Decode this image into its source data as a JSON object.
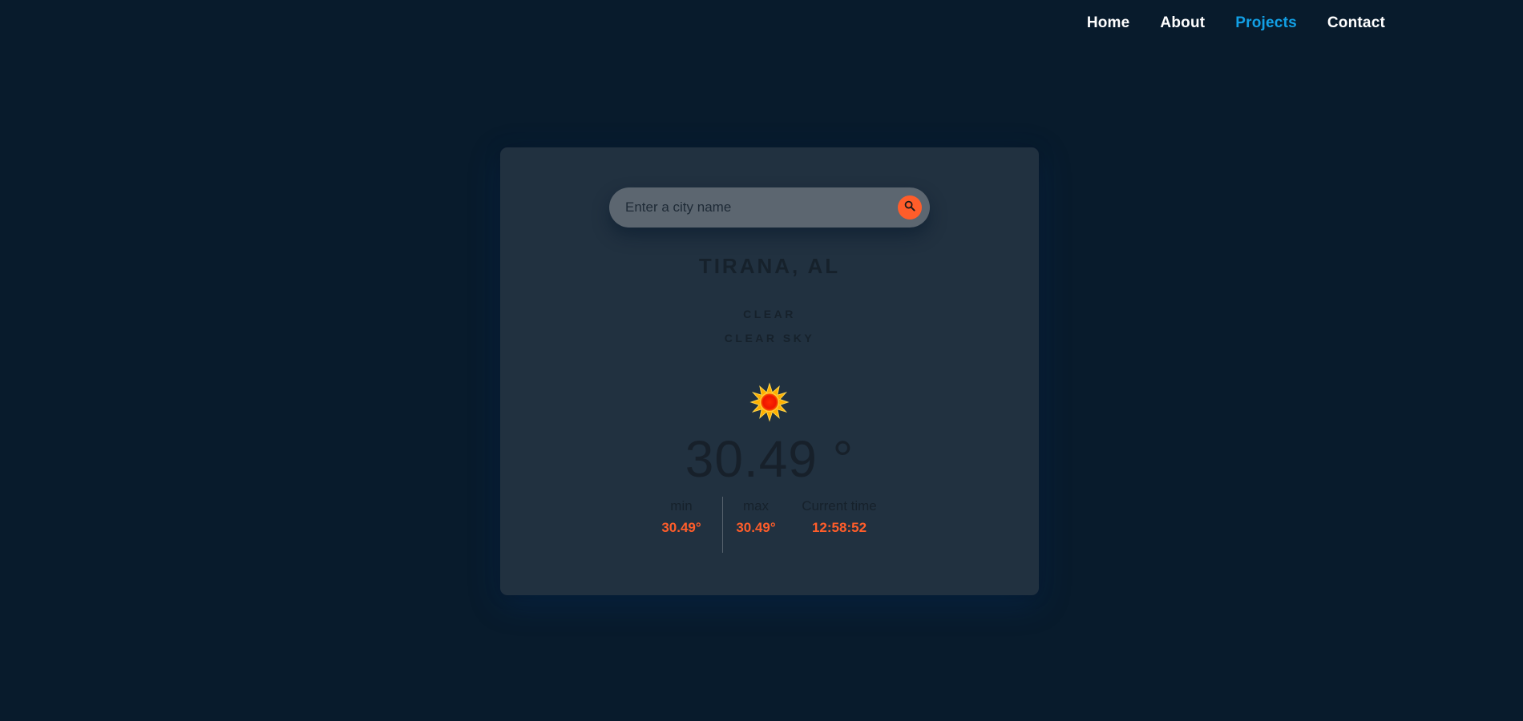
{
  "nav": {
    "items": [
      {
        "label": "Home"
      },
      {
        "label": "About"
      },
      {
        "label": "Projects"
      },
      {
        "label": "Contact"
      }
    ],
    "active_index": 2
  },
  "search": {
    "placeholder": "Enter a city name",
    "value": "",
    "button_icon": "search-icon"
  },
  "weather": {
    "city": "TIRANA, AL",
    "main": "CLEAR",
    "description": "CLEAR SKY",
    "icon": "sun-icon",
    "temperature": "30.49 °",
    "min_label": "min",
    "min_value": "30.49°",
    "max_label": "max",
    "max_value": "30.49°",
    "time_label": "Current time",
    "time_value": "12:58:52"
  },
  "colors": {
    "background": "#081b2c",
    "card": "#213140",
    "accent": "#ff5d2a",
    "nav_active": "#12a0e6",
    "text_dark": "#16212b"
  }
}
